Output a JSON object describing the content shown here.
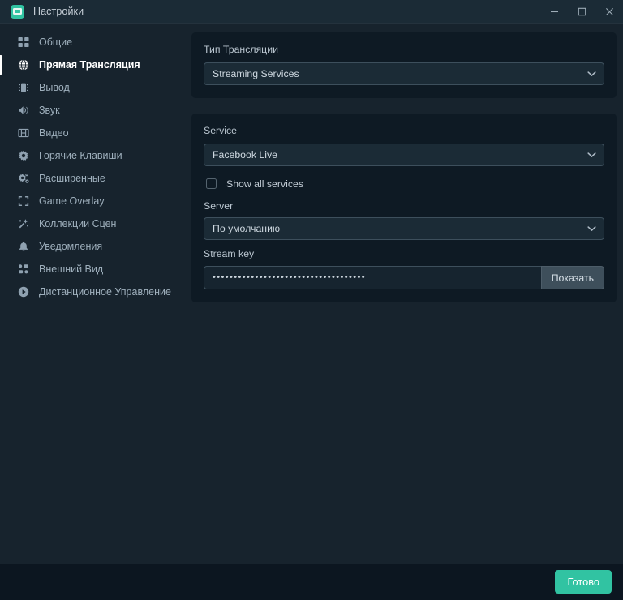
{
  "window": {
    "title": "Настройки",
    "app_icon": "streamlabs-icon",
    "controls": {
      "minimize": "minimize-icon",
      "maximize": "maximize-icon",
      "close": "close-icon"
    }
  },
  "theme": {
    "background": "#17232d",
    "panel": "#0e1a24",
    "titlebar": "#1b2b36",
    "footer": "#0c1620",
    "accent": "#31c3a2",
    "border": "#3d4f5c",
    "text": "#c8d2da",
    "text_active": "#ffffff"
  },
  "sidebar": {
    "items": [
      {
        "label": "Общие",
        "icon": "grid-icon",
        "active": false
      },
      {
        "label": "Прямая Трансляция",
        "icon": "globe-icon",
        "active": true
      },
      {
        "label": "Вывод",
        "icon": "chip-icon",
        "active": false
      },
      {
        "label": "Звук",
        "icon": "speaker-icon",
        "active": false
      },
      {
        "label": "Видео",
        "icon": "film-icon",
        "active": false
      },
      {
        "label": "Горячие Клавиши",
        "icon": "gear-icon",
        "active": false
      },
      {
        "label": "Расширенные",
        "icon": "gears-icon",
        "active": false
      },
      {
        "label": "Game Overlay",
        "icon": "expand-icon",
        "active": false
      },
      {
        "label": "Коллекции Сцен",
        "icon": "wand-icon",
        "active": false
      },
      {
        "label": "Уведомления",
        "icon": "bell-icon",
        "active": false
      },
      {
        "label": "Внешний Вид",
        "icon": "layout-icon",
        "active": false
      },
      {
        "label": "Дистанционное Управление",
        "icon": "play-circle-icon",
        "active": false
      }
    ]
  },
  "main": {
    "stream_type": {
      "label": "Тип Трансляции",
      "value": "Streaming Services",
      "chevron": "chevron-down-icon"
    },
    "service": {
      "label": "Service",
      "value": "Facebook Live",
      "chevron": "chevron-down-icon"
    },
    "show_all": {
      "label": "Show all services",
      "checked": false
    },
    "server": {
      "label": "Server",
      "value": "По умолчанию",
      "chevron": "chevron-down-icon"
    },
    "stream_key": {
      "label": "Stream key",
      "masked_value": "••••••••••••••••••••••••••••••••••••",
      "show_button": "Показать"
    }
  },
  "footer": {
    "done_label": "Готово"
  }
}
